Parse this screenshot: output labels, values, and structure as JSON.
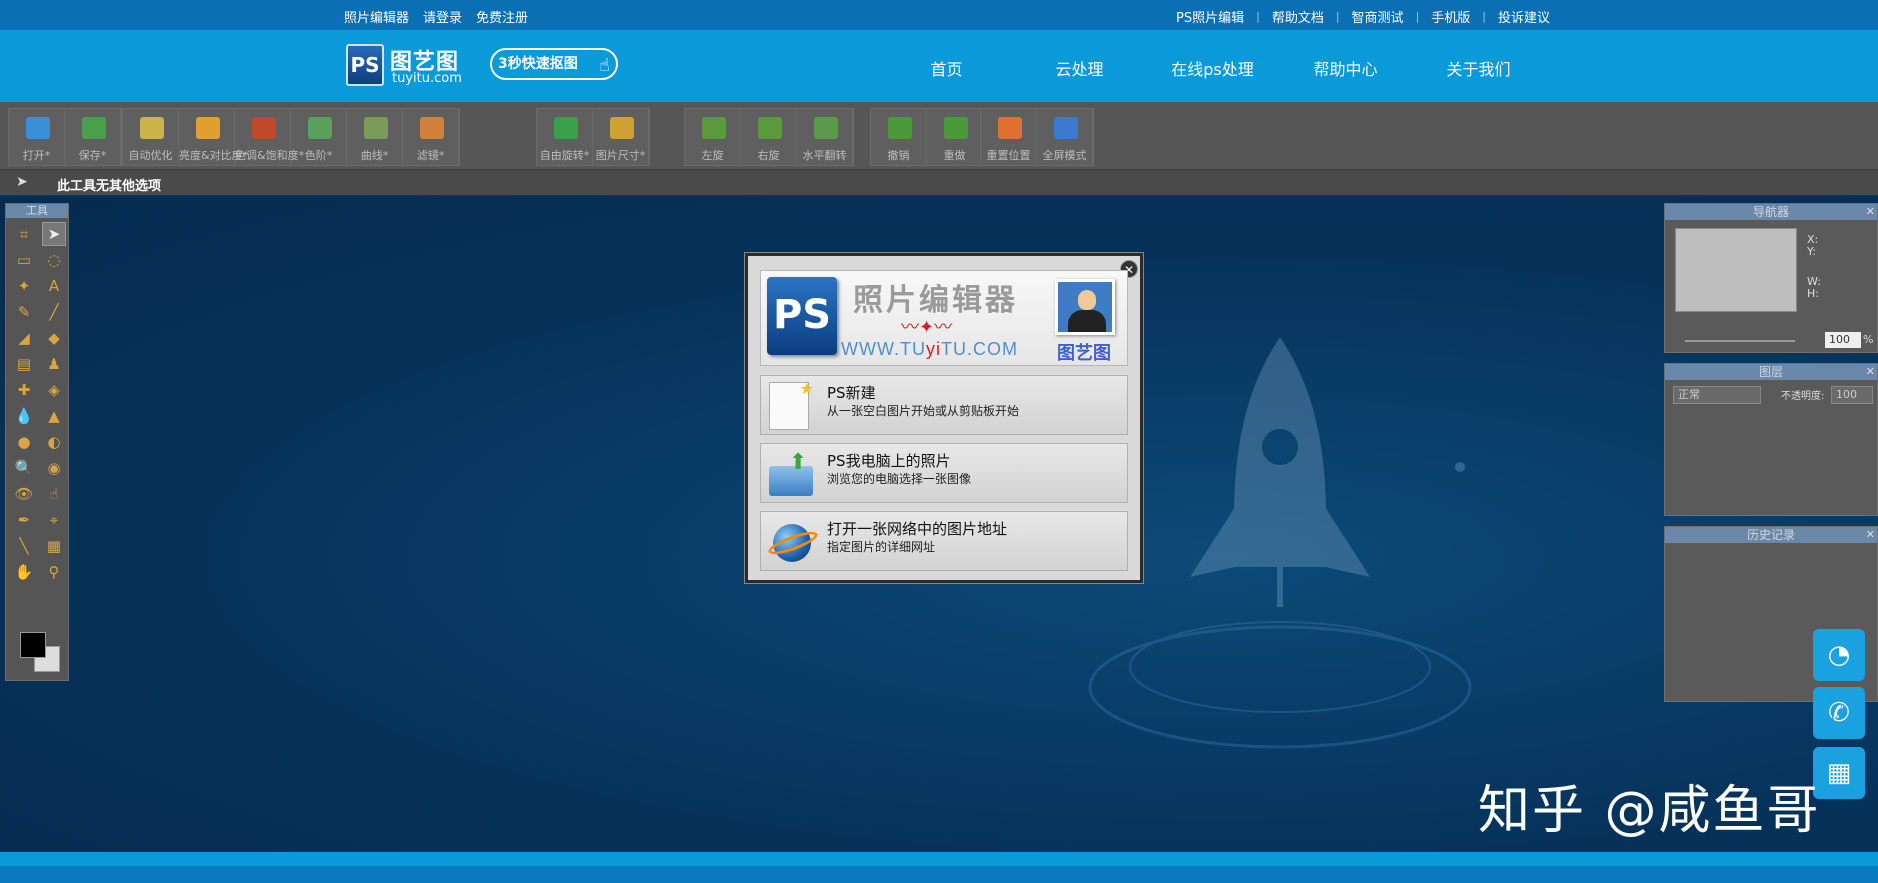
{
  "topbar": {
    "left_links": [
      "照片编辑器",
      "请登录",
      "免费注册"
    ],
    "right_links": [
      "PS照片编辑",
      "帮助文档",
      "智商测试",
      "手机版",
      "投诉建议"
    ],
    "separator": "|"
  },
  "header": {
    "logo_ps": "PS",
    "logo_cn": "图艺图",
    "logo_en": "tuyitu.com",
    "quick_button": "3秒快速抠图",
    "nav": [
      "首页",
      "云处理",
      "在线ps处理",
      "帮助中心",
      "关于我们"
    ]
  },
  "toolbar": {
    "groups": [
      [
        {
          "label": "打开*",
          "icon": "open-icon",
          "color": "#3b8fd6"
        },
        {
          "label": "保存*",
          "icon": "save-icon",
          "color": "#4aa04a"
        }
      ],
      [
        {
          "label": "自动优化",
          "icon": "auto-enhance-icon",
          "color": "#c9b34a"
        },
        {
          "label": "亮度&对比度*",
          "icon": "brightness-icon",
          "color": "#e0a030"
        },
        {
          "label": "色调&饱和度*",
          "icon": "hue-icon",
          "color": "#c04a2a"
        },
        {
          "label": "色阶*",
          "icon": "levels-icon",
          "color": "#5aa05a"
        },
        {
          "label": "曲线*",
          "icon": "curves-icon",
          "color": "#7a9a5a"
        },
        {
          "label": "滤镜*",
          "icon": "filter-icon",
          "color": "#d0803a"
        }
      ],
      [
        {
          "label": "自由旋转*",
          "icon": "free-rotate-icon",
          "color": "#3aa04a"
        },
        {
          "label": "图片尺寸*",
          "icon": "image-size-icon",
          "color": "#d0a030"
        }
      ],
      [
        {
          "label": "左旋",
          "icon": "rotate-left-icon",
          "color": "#5a9a3a"
        },
        {
          "label": "右旋",
          "icon": "rotate-right-icon",
          "color": "#5a9a3a"
        },
        {
          "label": "水平翻转",
          "icon": "flip-horizontal-icon",
          "color": "#5a9a4a"
        }
      ],
      [
        {
          "label": "撤销",
          "icon": "undo-icon",
          "color": "#4a9a3a"
        },
        {
          "label": "重做",
          "icon": "redo-icon",
          "color": "#4a9a3a"
        }
      ],
      [
        {
          "label": "重置位置",
          "icon": "reset-position-icon",
          "color": "#e07030"
        },
        {
          "label": "全屏模式",
          "icon": "fullscreen-icon",
          "color": "#3a7ad0"
        }
      ]
    ]
  },
  "options_bar": {
    "text": "此工具无其他选项"
  },
  "tools_panel": {
    "title": "工具",
    "tools": [
      "crop-icon",
      "move-icon",
      "marquee-icon",
      "lasso-icon",
      "magic-wand-icon",
      "text-icon",
      "pencil-icon",
      "brush-icon",
      "eraser-icon",
      "paint-bucket-icon",
      "gradient-icon",
      "stamp-icon",
      "healing-icon",
      "replace-color-icon",
      "blur-icon",
      "sharpen-icon",
      "dodge-icon",
      "burn-icon",
      "zoom-glass-icon",
      "sponge-icon",
      "red-eye-icon",
      "smudge-icon",
      "pen-icon",
      "color-picker-icon",
      "line-icon",
      "measure-icon",
      "hand-icon",
      "zoom-icon"
    ],
    "tool_glyphs": [
      "⌗",
      "➤",
      "▭",
      "◌",
      "✦",
      "A",
      "✎",
      "╱",
      "◢",
      "◆",
      "▤",
      "♟",
      "✚",
      "◈",
      "💧",
      "▲",
      "●",
      "◐",
      "🔍",
      "◉",
      "👁",
      "☝",
      "✒",
      "⌖",
      "╲",
      "▦",
      "✋",
      "⚲"
    ]
  },
  "navigator_panel": {
    "title": "导航器",
    "x_label": "X:",
    "y_label": "Y:",
    "w_label": "W:",
    "h_label": "H:",
    "zoom": "100",
    "percent": "%"
  },
  "layers_panel": {
    "title": "图层",
    "blend_mode": "正常",
    "opacity_label": "不透明度:",
    "opacity_value": "100"
  },
  "history_panel": {
    "title": "历史记录"
  },
  "modal": {
    "banner_ps": "PS",
    "banner_title": "照片编辑器",
    "banner_url_a": "WWW.TU",
    "banner_url_y": "yi",
    "banner_url_b": "TU.COM",
    "banner_brand": "图艺图",
    "options": [
      {
        "title": "PS新建",
        "subtitle": "从一张空白图片开始或从剪贴板开始",
        "icon": "new-document-icon"
      },
      {
        "title": "PS我电脑上的照片",
        "subtitle": "浏览您的电脑选择一张图像",
        "icon": "open-folder-icon"
      },
      {
        "title": "打开一张网络中的图片地址",
        "subtitle": "指定图片的详细网址",
        "icon": "web-globe-icon"
      }
    ]
  },
  "watermark": "知乎 @咸鱼哥",
  "float_buttons": [
    "qq-icon",
    "phone-icon",
    "qr-code-icon"
  ]
}
